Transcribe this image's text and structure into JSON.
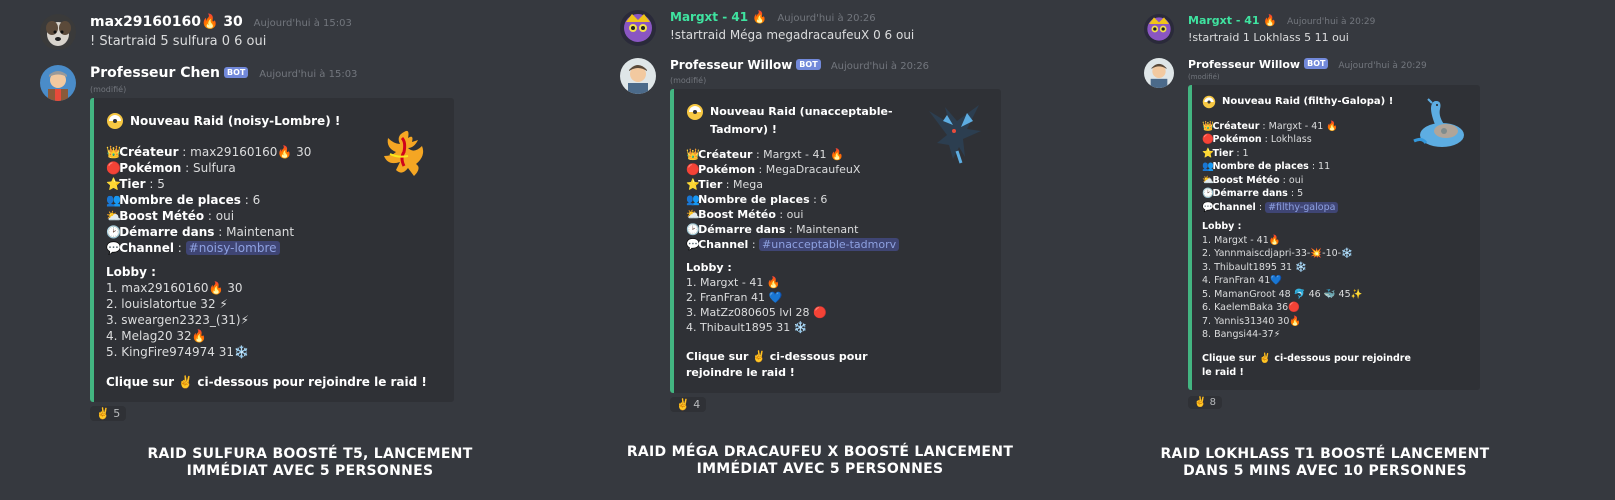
{
  "panels": [
    {
      "user": {
        "name": "max29160160",
        "badge": "🔥",
        "level": "30",
        "time": "Aujourd'hui à 15:03",
        "command": "! Startraid 5 sulfura 0 6 oui"
      },
      "bot": {
        "name": "Professeur Chen",
        "tag": "BOT",
        "time": "Aujourd'hui à 15:03",
        "edited": "(modifié)"
      },
      "embed": {
        "title": "Nouveau Raid (noisy-Lombre) !",
        "fields": [
          {
            "icon": "👑",
            "label": "Créateur",
            "value": " : max29160160🔥 30"
          },
          {
            "icon": "🔴",
            "label": "Pokémon",
            "value": " : Sulfura"
          },
          {
            "icon": "⭐",
            "label": "Tier",
            "value": " : 5"
          },
          {
            "icon": "👥",
            "label": "Nombre de places",
            "value": " : 6"
          },
          {
            "icon": "⛅",
            "label": "Boost Météo",
            "value": " : oui"
          },
          {
            "icon": "🕑",
            "label": "Démarre dans",
            "value": " : Maintenant"
          },
          {
            "icon": "💬",
            "label": "Channel",
            "value": " : ",
            "channel": "#noisy-lombre"
          }
        ],
        "lobby_title": "Lobby :",
        "lobby": [
          "1. max29160160🔥 30",
          "2. louislatortue 32 ⚡",
          "3. sweargen2323_(31)⚡",
          "4. Melag20 32🔥",
          "5. KingFire974974 31❄️"
        ],
        "footer": "Clique sur ✌️ ci-dessous pour rejoindre le raid !"
      },
      "reaction": {
        "emoji": "✌️",
        "count": "5"
      },
      "caption": [
        "RAID SULFURA BOOSTÉ T5, LANCEMENT",
        "IMMÉDIAT AVEC 5 PERSONNES"
      ]
    },
    {
      "user": {
        "name": "Margxt - 41",
        "badge": "🔥",
        "level": "",
        "time": "Aujourd'hui à 20:26",
        "command": "!startraid Méga megadracaufeuX 0 6 oui"
      },
      "bot": {
        "name": "Professeur Willow",
        "tag": "BOT",
        "time": "Aujourd'hui à 20:26",
        "edited": "(modifié)"
      },
      "embed": {
        "title": "Nouveau Raid (unacceptable-Tadmorv) !",
        "fields": [
          {
            "icon": "👑",
            "label": "Créateur",
            "value": " : Margxt - 41 🔥"
          },
          {
            "icon": "🔴",
            "label": "Pokémon",
            "value": " : MegaDracaufeuX"
          },
          {
            "icon": "⭐",
            "label": "Tier",
            "value": " : Mega"
          },
          {
            "icon": "👥",
            "label": "Nombre de places",
            "value": " : 6"
          },
          {
            "icon": "⛅",
            "label": "Boost Météo",
            "value": " : oui"
          },
          {
            "icon": "🕑",
            "label": "Démarre dans",
            "value": " : Maintenant"
          },
          {
            "icon": "💬",
            "label": "Channel",
            "value": " : ",
            "channel": "#unacceptable-tadmorv"
          }
        ],
        "lobby_title": "Lobby :",
        "lobby": [
          "1. Margxt - 41 🔥",
          "2. FranFran 41 💙",
          "3. MatZz080605 lvl 28 🔴",
          "4. Thibault1895 31 ❄️"
        ],
        "footer": "Clique sur ✌️ ci-dessous pour rejoindre le raid !"
      },
      "reaction": {
        "emoji": "✌️",
        "count": "4"
      },
      "caption": [
        "RAID MÉGA DRACAUFEU X BOOSTÉ LANCEMENT",
        "IMMÉDIAT AVEC 5 PERSONNES"
      ]
    },
    {
      "user": {
        "name": "Margxt - 41",
        "badge": "🔥",
        "level": "",
        "time": "Aujourd'hui à 20:29",
        "command": "!startraid 1 Lokhlass 5 11 oui"
      },
      "bot": {
        "name": "Professeur Willow",
        "tag": "BOT",
        "time": "Aujourd'hui à 20:29",
        "edited": "(modifié)"
      },
      "embed": {
        "title": "Nouveau Raid (filthy-Galopa) !",
        "fields": [
          {
            "icon": "👑",
            "label": "Créateur",
            "value": " : Margxt - 41 🔥"
          },
          {
            "icon": "🔴",
            "label": "Pokémon",
            "value": " : Lokhlass"
          },
          {
            "icon": "⭐",
            "label": "Tier",
            "value": " : 1"
          },
          {
            "icon": "👥",
            "label": "Nombre de places",
            "value": " : 11"
          },
          {
            "icon": "⛅",
            "label": "Boost Météo",
            "value": " : oui"
          },
          {
            "icon": "🕑",
            "label": "Démarre dans",
            "value": " : 5"
          },
          {
            "icon": "💬",
            "label": "Channel",
            "value": " : ",
            "channel": "#filthy-galopa"
          }
        ],
        "lobby_title": "Lobby :",
        "lobby": [
          "1. Margxt - 41🔥",
          "2. Yannmaiscdjapri-33-💥-10-❄️",
          "3. Thibault1895 31 ❄️",
          "4. FranFran 41💙",
          "5. MamanGroot 48 🐬 46 🐳 45✨",
          "6. KaelemBaka 36🔴",
          "7. Yannis31340 30🔥",
          "8. Bangsi44-37⚡"
        ],
        "footer": "Clique sur ✌️ ci-dessous pour rejoindre le raid !"
      },
      "reaction": {
        "emoji": "✌️",
        "count": "8"
      },
      "caption": [
        "RAID LOKHLASS T1 BOOSTÉ LANCEMENT",
        "DANS 5 MINS AVEC 10 PERSONNES"
      ]
    }
  ]
}
